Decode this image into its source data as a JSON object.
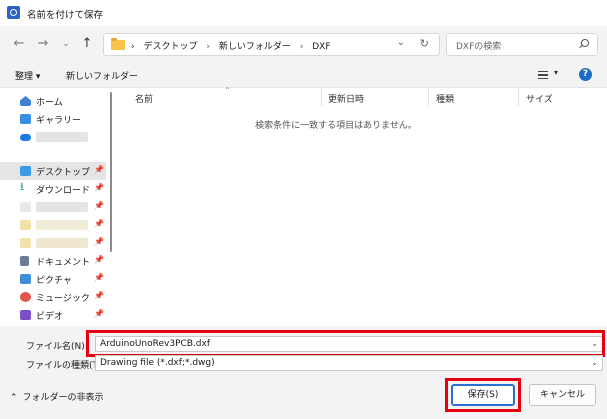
{
  "window": {
    "title": "名前を付けて保存"
  },
  "address": {
    "crumbs": [
      "デスクトップ",
      "新しいフォルダー",
      "DXF"
    ],
    "sep": "›"
  },
  "search": {
    "placeholder": "DXFの検索"
  },
  "toolbar": {
    "organize": "整理 ▾",
    "new_folder": "新しいフォルダー"
  },
  "sidebar": {
    "items": [
      {
        "label": "ホーム",
        "icon": "home-icon"
      },
      {
        "label": "ギャラリー",
        "icon": "gallery-icon"
      },
      {
        "label": "",
        "icon": "onedrive-icon"
      },
      {
        "label": "デスクトップ",
        "icon": "desktop-icon",
        "selected": true
      },
      {
        "label": "ダウンロード",
        "icon": "download-icon"
      },
      {
        "label": "ドキュメント",
        "icon": "document-icon"
      },
      {
        "label": "ピクチャ",
        "icon": "picture-icon"
      },
      {
        "label": "ミュージック",
        "icon": "music-icon"
      },
      {
        "label": "ビデオ",
        "icon": "video-icon"
      }
    ],
    "pin": "📌"
  },
  "columns": {
    "name": "名前",
    "date": "更新日時",
    "type": "種類",
    "size": "サイズ"
  },
  "empty_message": "検索条件に一致する項目はありません。",
  "form": {
    "filename_label": "ファイル名(N):",
    "filename_value": "ArduinoUnoRev3PCB.dxf",
    "filetype_label": "ファイルの種類(T):",
    "filetype_value": "Drawing file (*.dxf;*.dwg)"
  },
  "footer": {
    "hide_folders": "フォルダーの非表示",
    "save": "保存(S)",
    "cancel": "キャンセル"
  },
  "colors": {
    "highlight": "#e60012",
    "accent": "#2a6fd1"
  }
}
